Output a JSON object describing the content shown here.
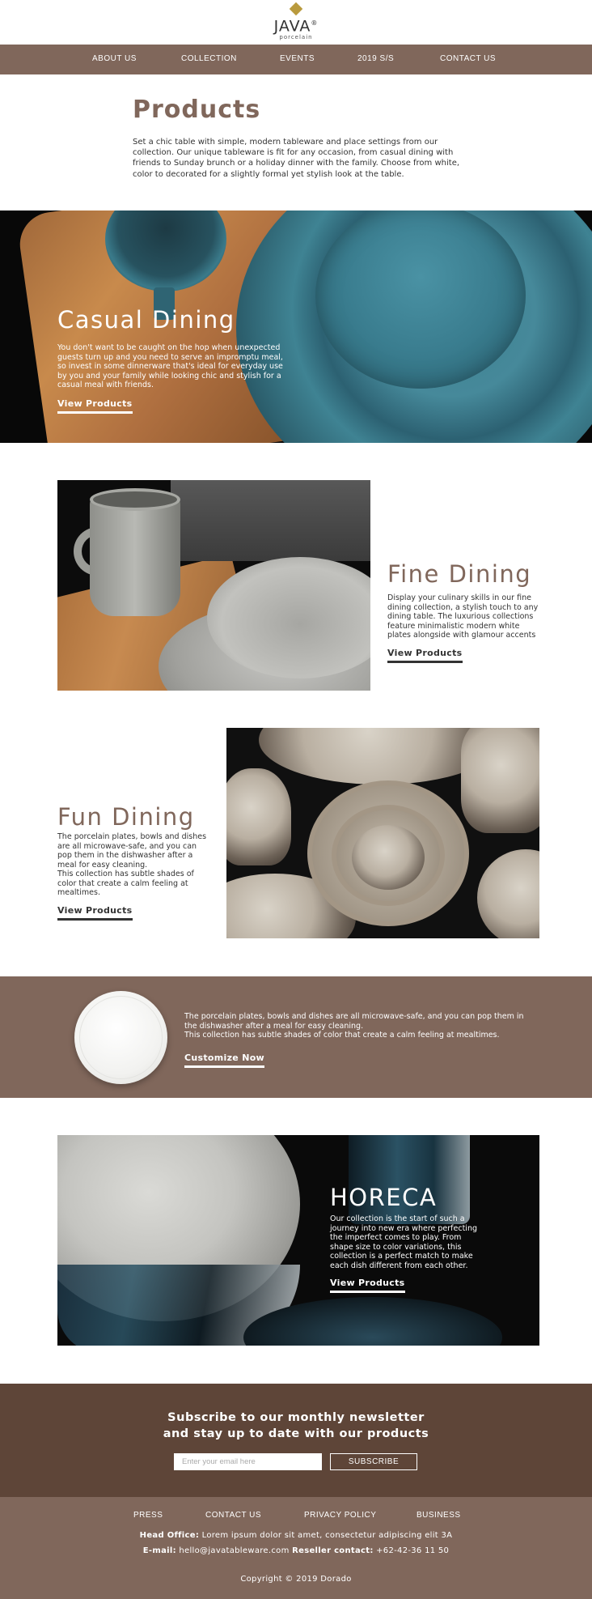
{
  "brand": {
    "logo_text": "JAVA",
    "logo_mark": "®",
    "logo_sub": "porcelain"
  },
  "nav": {
    "items": [
      "ABOUT US",
      "COLLECTION",
      "EVENTS",
      "2019 S/S",
      "CONTACT US"
    ]
  },
  "intro": {
    "title": "Products",
    "body": "Set a chic table with simple, modern tableware and place settings from our collection. Our unique tableware is fit for any occasion, from casual dining with friends to Sunday brunch or a holiday dinner with the family. Choose from white, color to decorated for a slightly formal yet stylish look at the table."
  },
  "casual": {
    "title": "Casual Dining",
    "body": "You don't want to be caught on the hop when unexpected guests turn up and you need to serve an impromptu meal, so invest in some dinnerware that's ideal for everyday use by you and your family while looking chic and stylish for a casual meal with friends.",
    "link": "View Products"
  },
  "fine": {
    "title": "Fine Dining",
    "body": "Display your culinary skills in our fine dining collection, a stylish touch to any dining table. The luxurious collections feature minimalistic modern white plates alongside with glamour accents",
    "link": "View Products"
  },
  "fun": {
    "title": "Fun Dining",
    "body1": "The porcelain plates, bowls and dishes are all microwave-safe, and you can pop them in the dishwasher after a meal for easy cleaning.",
    "body2": "This collection has subtle shades of color that create a calm feeling at mealtimes.",
    "link": "View Products"
  },
  "banner": {
    "body1": "The porcelain plates, bowls and dishes are all microwave-safe, and you can pop them in the dishwasher after a meal for easy cleaning.",
    "body2": "This collection has subtle shades of color that create a calm feeling at mealtimes.",
    "link": "Customize Now"
  },
  "horeca": {
    "title": "HORECA",
    "body": "Our collection is the start of such a journey into new era where perfecting the imperfect comes to play. From shape size to color variations, this collection is a perfect match to make each dish different from each other.",
    "link": "View Products"
  },
  "newsletter": {
    "line1": "Subscribe to our monthly newsletter",
    "line2": "and stay up to date with our products",
    "placeholder": "Enter your email here",
    "button": "SUBSCRIBE"
  },
  "footer": {
    "links": [
      "PRESS",
      "CONTACT US",
      "PRIVACY POLICY",
      "BUSINESS"
    ],
    "office_label": "Head Office:",
    "office_value": "Lorem ipsum dolor sit amet, consectetur adipiscing elit 3A",
    "email_label": "E-mail:",
    "email_value": "hello@javatableware.com",
    "reseller_label": "Reseller contact:",
    "reseller_value": "+62-42-36 11 50",
    "copyright": "Copyright © 2019 Dorado"
  },
  "colors": {
    "brand_brown": "#80675b",
    "dark_brown": "#5e4538",
    "logo_gold": "#b99a3d"
  }
}
